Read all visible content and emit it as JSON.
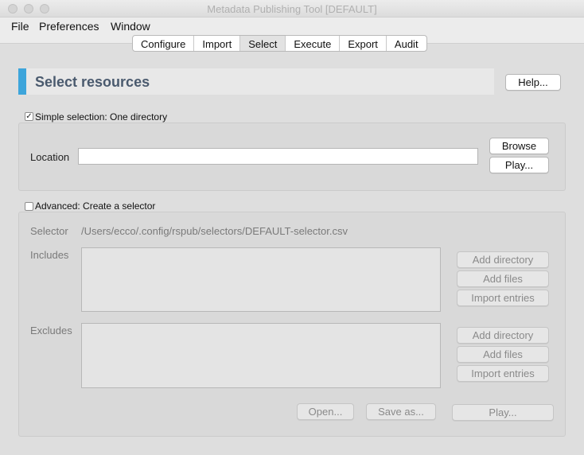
{
  "window": {
    "title": "Metadata Publishing Tool [DEFAULT]"
  },
  "menu": [
    "File",
    "Preferences",
    "Window"
  ],
  "tabs": [
    "Configure",
    "Import",
    "Select",
    "Execute",
    "Export",
    "Audit"
  ],
  "active_tab": "Select",
  "page": {
    "heading": "Select resources",
    "help_label": "Help..."
  },
  "simple": {
    "checkbox_label": "Simple selection: One directory",
    "checked": true,
    "location_label": "Location",
    "location_value": "",
    "browse_label": "Browse",
    "play_label": "Play..."
  },
  "advanced": {
    "checkbox_label": "Advanced: Create a selector",
    "checked": false,
    "selector_label": "Selector",
    "selector_path": "/Users/ecco/.config/rspub/selectors/DEFAULT-selector.csv",
    "includes_label": "Includes",
    "excludes_label": "Excludes",
    "add_directory_label": "Add directory",
    "add_files_label": "Add files",
    "import_entries_label": "Import entries",
    "open_label": "Open...",
    "save_as_label": "Save as...",
    "play_label": "Play..."
  },
  "colors": {
    "accent": "#3da5db",
    "heading_text": "#4a5a6e"
  }
}
